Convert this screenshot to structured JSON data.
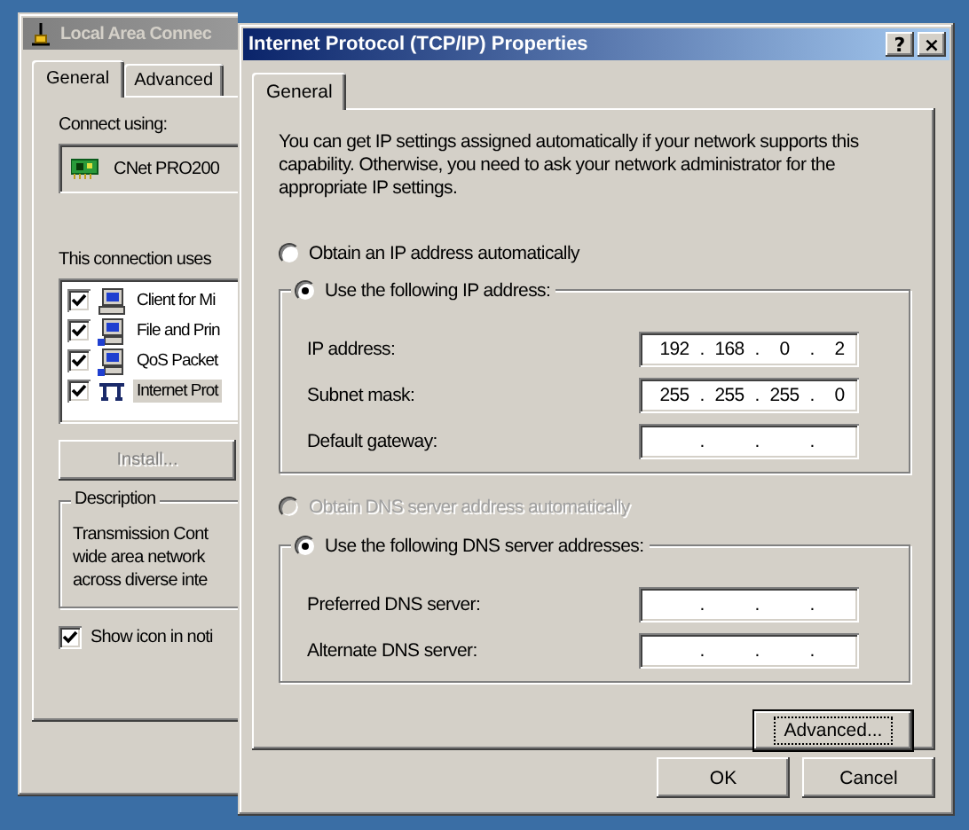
{
  "background_window": {
    "title": "Local Area Connec",
    "tabs": [
      {
        "label": "General",
        "selected": true
      },
      {
        "label": "Advanced",
        "selected": false
      }
    ],
    "connect_using_label": "Connect using:",
    "adapter": "CNet PRO200",
    "components_label": "This connection uses",
    "components": [
      {
        "label": "Client for Mi",
        "checked": true,
        "selected": false,
        "kind": "client"
      },
      {
        "label": "File and Prin",
        "checked": true,
        "selected": false,
        "kind": "service"
      },
      {
        "label": "QoS Packet",
        "checked": true,
        "selected": false,
        "kind": "service"
      },
      {
        "label": "Internet Prot",
        "checked": true,
        "selected": true,
        "kind": "protocol"
      }
    ],
    "install_button": {
      "label": "Install...",
      "disabled": true
    },
    "description": {
      "title": "Description",
      "lines": [
        "Transmission Cont",
        "wide area network",
        "across diverse inte"
      ]
    },
    "show_icon": {
      "label": "Show icon in noti",
      "checked": true
    }
  },
  "dialog": {
    "title": "Internet Protocol (TCP/IP) Properties",
    "title_buttons": [
      "?",
      "×"
    ],
    "tabs": [
      {
        "label": "General",
        "selected": true
      }
    ],
    "intro": "You can get IP settings assigned automatically if your network supports this capability. Otherwise, you need to ask your network administrator for the appropriate IP settings.",
    "ip_mode": [
      {
        "label": "Obtain an IP address automatically",
        "selected": false,
        "disabled": false
      },
      {
        "label": "Use the following IP address:",
        "selected": true,
        "disabled": false
      }
    ],
    "ip_fields": [
      {
        "label": "IP address:",
        "parts": [
          "192",
          ".",
          "168",
          ".",
          "0",
          ".",
          "2"
        ]
      },
      {
        "label": "Subnet mask:",
        "parts": [
          "255",
          ".",
          "255",
          ".",
          "255",
          ".",
          "0"
        ]
      },
      {
        "label": "Default gateway:",
        "parts": [
          ".",
          ".",
          "."
        ]
      }
    ],
    "dns_mode": [
      {
        "label": "Obtain DNS server address automatically",
        "selected": false,
        "disabled": true
      },
      {
        "label": "Use the following DNS server addresses:",
        "selected": true,
        "disabled": false
      }
    ],
    "dns_fields": [
      {
        "label": "Preferred DNS server:",
        "parts": [
          ".",
          ".",
          "."
        ]
      },
      {
        "label": "Alternate DNS server:",
        "parts": [
          ".",
          ".",
          "."
        ]
      }
    ],
    "advanced_button": {
      "label": "Advanced...",
      "focused": true
    },
    "buttons": [
      "OK",
      "Cancel"
    ]
  }
}
